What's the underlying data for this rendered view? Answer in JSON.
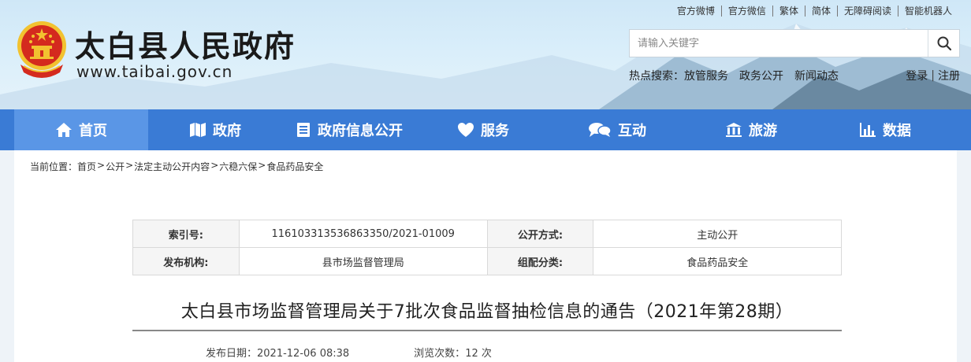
{
  "header": {
    "site_title": "太白县人民政府",
    "site_url": "www.taibai.gov.cn",
    "top_links": [
      "官方微博",
      "官方微信",
      "繁体",
      "简体",
      "无障碍阅读",
      "智能机器人"
    ],
    "search_placeholder": "请输入关键字",
    "hot_search_label": "热点搜索：",
    "hot_search_items": [
      "放管服务",
      "政务公开",
      "新闻动态"
    ],
    "login_label": "登录",
    "login_sep": "|",
    "register_label": "注册"
  },
  "nav": {
    "items": [
      {
        "label": "首页",
        "icon": "home-icon"
      },
      {
        "label": "政府",
        "icon": "map-icon"
      },
      {
        "label": "政府信息公开",
        "icon": "document-list-icon"
      },
      {
        "label": "服务",
        "icon": "heart-icon"
      },
      {
        "label": "互动",
        "icon": "chat-icon"
      },
      {
        "label": "旅游",
        "icon": "building-icon"
      },
      {
        "label": "数据",
        "icon": "bar-chart-icon"
      }
    ]
  },
  "breadcrumb": {
    "prefix": "当前位置：",
    "items": [
      "首页",
      "公开",
      "法定主动公开内容",
      "六稳六保",
      "食品药品安全"
    ],
    "arrow": ">"
  },
  "meta": {
    "index_label": "索引号:",
    "index_value": "116103313536863350/2021-01009",
    "open_mode_label": "公开方式:",
    "open_mode_value": "主动公开",
    "publisher_label": "发布机构:",
    "publisher_value": "县市场监督管理局",
    "category_label": "组配分类:",
    "category_value": "食品药品安全"
  },
  "article": {
    "title": "太白县市场监督管理局关于7批次食品监督抽检信息的通告（2021年第28期）",
    "date_label": "发布日期：",
    "date_value": "2021-12-06 08:38",
    "views_label": "浏览次数：",
    "views_value": "12 次"
  },
  "colors": {
    "nav_bg": "#3a7bd5",
    "nav_active": "#5a96e6",
    "emblem_red": "#d42a1e",
    "emblem_gold": "#f2c230"
  }
}
